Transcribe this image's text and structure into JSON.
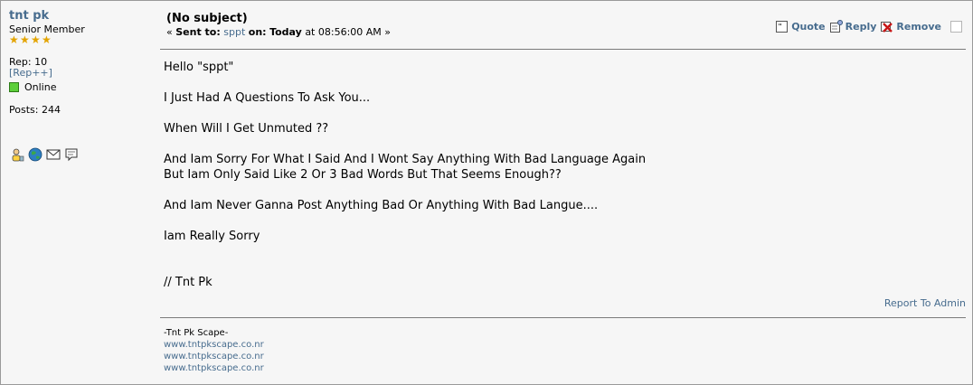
{
  "poster": {
    "name": "tnt pk",
    "title": "Senior Member",
    "stars": 4,
    "rep": "Rep: 10",
    "rep_link": "[Rep++]",
    "status": "Online",
    "posts": "Posts: 244",
    "icons": [
      "profile-icon",
      "website-icon",
      "email-icon",
      "pm-icon"
    ]
  },
  "message": {
    "subject": "(No subject)",
    "sent_prefix": "«",
    "sent_to_label": "Sent to:",
    "recipient": "sppt",
    "on_label": "on:",
    "day": "Today",
    "at_label": "at",
    "time": "08:56:00 AM",
    "sent_suffix": "»",
    "lines": [
      "Hello \"sppt\"",
      "",
      "I Just Had A Questions To Ask You...",
      "",
      "When Will I Get Unmuted ??",
      "",
      "And Iam Sorry For What I Said And I Wont Say Anything With Bad Language Again",
      "But Iam Only Said Like 2 Or 3 Bad Words But That Seems Enough??",
      "",
      "And Iam Never Ganna Post Anything Bad Or Anything With Bad Langue....",
      "",
      "Iam Really Sorry",
      "",
      "",
      "// Tnt Pk"
    ]
  },
  "actions": {
    "quote": "Quote",
    "reply": "Reply",
    "remove": "Remove"
  },
  "report": "Report To Admin",
  "signature": {
    "title": "-Tnt Pk Scape-",
    "links": [
      "www.tntpkscape.co.nr",
      "www.tntpkscape.co.nr",
      "www.tntpkscape.co.nr"
    ]
  }
}
